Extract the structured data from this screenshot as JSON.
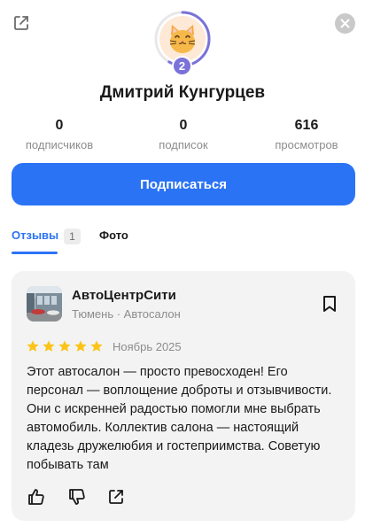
{
  "profile": {
    "name": "Дмитрий Кунгурцев",
    "level": "2",
    "avatar": "cat-emoji-avatar",
    "accent_color": "#7b72d9"
  },
  "stats": [
    {
      "value": "0",
      "label": "подписчиков"
    },
    {
      "value": "0",
      "label": "подписок"
    },
    {
      "value": "616",
      "label": "просмотров"
    }
  ],
  "actions": {
    "subscribe_label": "Подписаться",
    "subscribe_color": "#2b73f5"
  },
  "tabs": [
    {
      "label": "Отзывы",
      "count": "1",
      "active": true
    },
    {
      "label": "Фото",
      "active": false
    }
  ],
  "review": {
    "org_name": "АвтоЦентрСити",
    "org_meta": "Тюмень · Автосалон",
    "rating": 5,
    "date": "Ноябрь 2025",
    "text": "Этот автосалон — просто превосходен! Его персонал — воплощение доброты и отзывчивости. Они с искренней радостью помогли мне выбрать автомобиль. Коллектив салона — настоящий кладезь дружелюбия и гостеприимства. Советую побывать там",
    "star_color": "#fcc419"
  },
  "icons": {
    "top_left": "share-icon",
    "top_right": "close-icon",
    "card_bookmark": "bookmark-icon",
    "footer": [
      "like-icon",
      "dislike-icon",
      "share-icon"
    ]
  }
}
